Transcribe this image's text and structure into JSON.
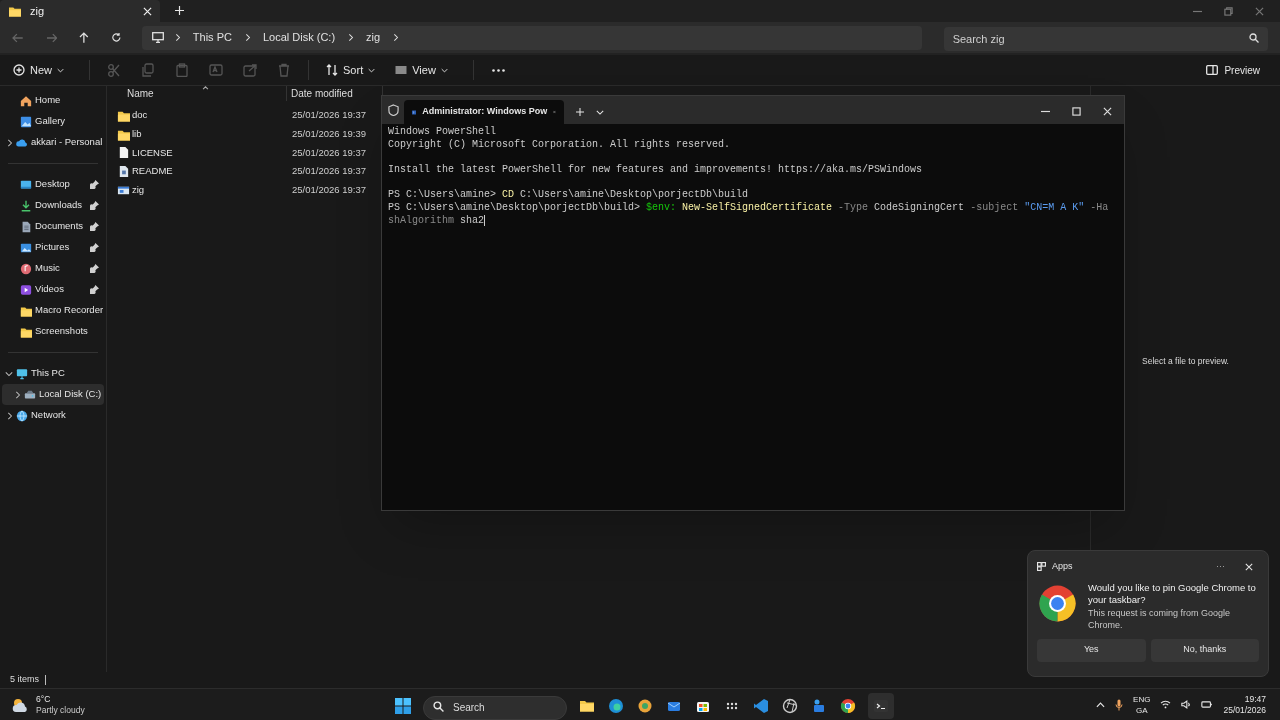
{
  "explorer": {
    "tabs": [
      {
        "label": "zig",
        "selected": true
      }
    ],
    "breadcrumb": [
      "This PC",
      "Local Disk (C:)",
      "zig"
    ],
    "search": {
      "placeholder": "Search zig"
    },
    "toolbar": [
      {
        "kind": "menu",
        "label": "New",
        "disabled": false
      },
      {
        "kind": "icon",
        "disabled": true
      },
      {
        "kind": "icon",
        "disabled": true
      },
      {
        "kind": "icon",
        "disabled": true
      },
      {
        "kind": "icon",
        "disabled": true
      },
      {
        "kind": "icon",
        "disabled": true
      },
      {
        "kind": "icon",
        "disabled": true
      },
      {
        "kind": "menu",
        "label": "Sort",
        "disabled": false
      },
      {
        "kind": "menu",
        "label": "View",
        "disabled": false
      },
      {
        "kind": "more",
        "disabled": false
      }
    ],
    "preview_button": "Preview",
    "sidebar": {
      "groups": [
        [
          {
            "label": "Home",
            "selected": false
          },
          {
            "label": "Gallery",
            "selected": false
          },
          {
            "label": "akkari - Personal",
            "selected": false,
            "expanded": false
          }
        ],
        [
          {
            "label": "Desktop",
            "selected": false,
            "pinned": true
          },
          {
            "label": "Downloads",
            "selected": false,
            "pinned": true
          },
          {
            "label": "Documents",
            "selected": false,
            "pinned": true
          },
          {
            "label": "Pictures",
            "selected": false,
            "pinned": true
          },
          {
            "label": "Music",
            "selected": false,
            "pinned": true
          },
          {
            "label": "Videos",
            "selected": false,
            "pinned": true
          },
          {
            "label": "Macro Recorder",
            "selected": false,
            "pinned": false
          },
          {
            "label": "Screenshots",
            "selected": false,
            "pinned": false
          }
        ],
        [
          {
            "label": "This PC",
            "selected": false,
            "expanded": true,
            "children": [
              {
                "label": "Local Disk (C:)",
                "selected": true,
                "expanded": false
              }
            ]
          },
          {
            "label": "Network",
            "selected": false,
            "expanded": false
          }
        ]
      ]
    },
    "columns": [
      "Name",
      "Date modified"
    ],
    "files": [
      {
        "name": "doc",
        "kind": "folder",
        "date": "25/01/2026 19:37"
      },
      {
        "name": "lib",
        "kind": "folder",
        "date": "25/01/2026 19:39"
      },
      {
        "name": "LICENSE",
        "kind": "text",
        "date": "25/01/2026 19:37"
      },
      {
        "name": "README",
        "kind": "document",
        "date": "25/01/2026 19:37"
      },
      {
        "name": "zig",
        "kind": "program",
        "date": "25/01/2026 19:37"
      }
    ],
    "preview_message": "Select a file to preview.",
    "status": "5 items"
  },
  "terminal": {
    "tabs": [
      {
        "label": "Administrator: Windows Pow",
        "selected": true
      }
    ],
    "lines": [
      {
        "kind": "text",
        "segments": [
          {
            "text": "Windows PowerShell",
            "kind": "plain"
          }
        ]
      },
      {
        "kind": "text",
        "segments": [
          {
            "text": "Copyright (C) Microsoft Corporation. All rights reserved.",
            "kind": "plain"
          }
        ]
      },
      {
        "kind": "blank"
      },
      {
        "kind": "text",
        "segments": [
          {
            "text": "Install the latest PowerShell for new features and improvements! https://aka.ms/PSWindows",
            "kind": "plain"
          }
        ]
      },
      {
        "kind": "blank"
      },
      {
        "kind": "text",
        "segments": [
          {
            "text": "PS C:\\Users\\amine> ",
            "kind": "plain"
          },
          {
            "text": "CD",
            "kind": "command"
          },
          {
            "text": " C:\\Users\\amine\\Desktop\\porjectDb\\build",
            "kind": "plain"
          }
        ]
      },
      {
        "kind": "text",
        "segments": [
          {
            "text": "PS C:\\Users\\amine\\Desktop\\porjectDb\\build> ",
            "kind": "plain"
          },
          {
            "text": "$env:",
            "kind": "variable"
          },
          {
            "text": " New-SelfSignedCertificate",
            "kind": "command"
          },
          {
            "text": " -Type",
            "kind": "parameter"
          },
          {
            "text": " CodeSigningCert",
            "kind": "plain"
          },
          {
            "text": " -subject",
            "kind": "parameter"
          },
          {
            "text": " \"CN=M A K\"",
            "kind": "string"
          },
          {
            "text": " -Ha",
            "kind": "parameter"
          }
        ]
      },
      {
        "kind": "text",
        "segments": [
          {
            "text": "shAlgorithm",
            "kind": "parameter"
          },
          {
            "text": " sha2",
            "kind": "plain"
          }
        ]
      }
    ]
  },
  "notification": {
    "app": "Apps",
    "more": "···",
    "title": "Would you like to pin Google Chrome to your taskbar?",
    "body": "This request is coming from Google Chrome.",
    "buttons": [
      "Yes",
      "No, thanks"
    ]
  },
  "taskbar": {
    "weather": {
      "temperature": "6°C",
      "condition": "Partly cloudy"
    },
    "search": {
      "placeholder": "Search"
    },
    "language": "ENG",
    "layout": "GA",
    "time": "19:47",
    "date": "25/01/2026"
  }
}
